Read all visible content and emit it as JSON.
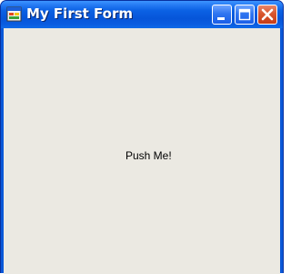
{
  "window": {
    "title": "My First Form",
    "icon": "form-app-icon",
    "caption_buttons": [
      "minimize-icon",
      "maximize-icon",
      "close-icon"
    ]
  },
  "form": {
    "button_label": "Push Me!"
  },
  "colors": {
    "titlebar": "#0655d9",
    "client_background": "#ebe9e2",
    "close_button": "#d8552e",
    "title_text": "#ffffff"
  }
}
